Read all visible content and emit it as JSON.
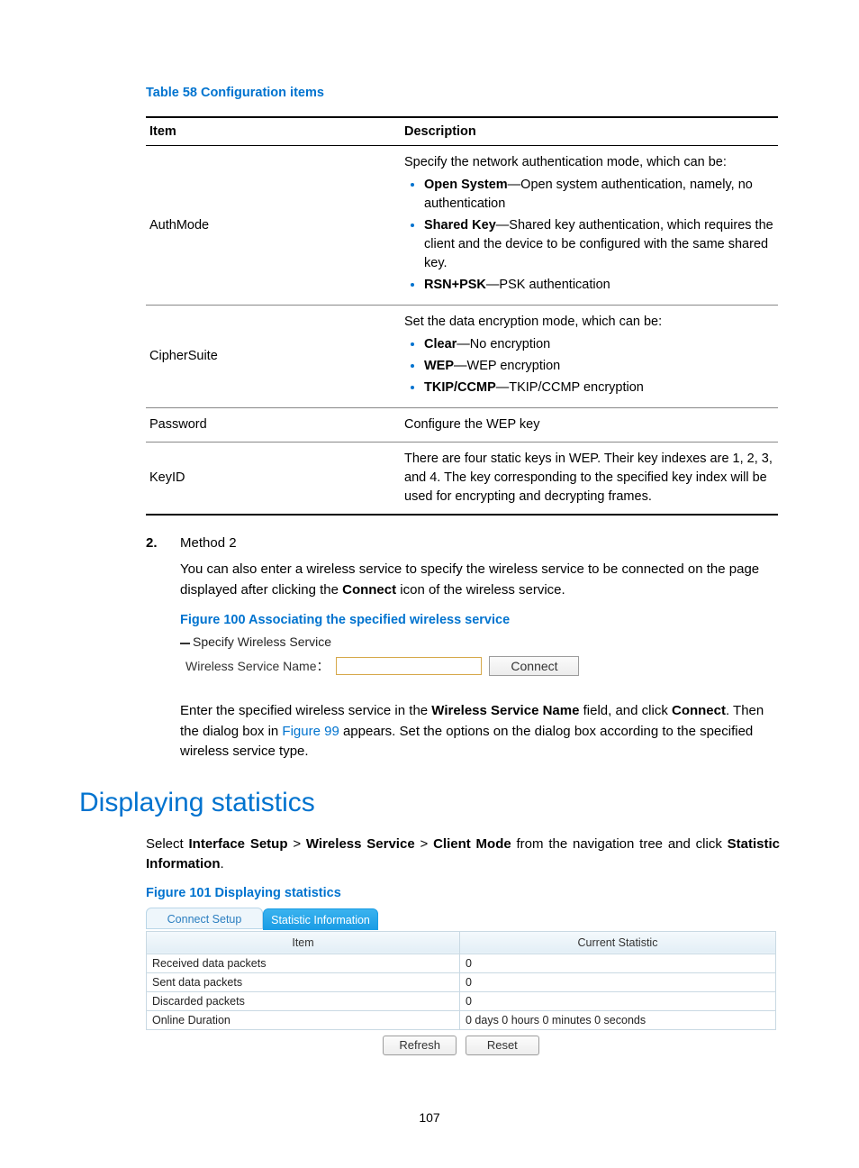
{
  "table58": {
    "caption": "Table 58 Configuration items",
    "headers": [
      "Item",
      "Description"
    ],
    "rows": [
      {
        "item": "AuthMode",
        "intro": "Specify the network authentication mode, which can be:",
        "bullets": [
          {
            "term": "Open System",
            "text": "—Open system authentication, namely, no authentication"
          },
          {
            "term": "Shared Key",
            "text": "—Shared key authentication, which requires the client and the device to be configured with the same shared key."
          },
          {
            "term": "RSN+PSK",
            "text": "—PSK authentication"
          }
        ]
      },
      {
        "item": "CipherSuite",
        "intro": "Set the data encryption mode, which can be:",
        "bullets": [
          {
            "term": "Clear",
            "text": "—No encryption"
          },
          {
            "term": "WEP",
            "text": "—WEP encryption"
          },
          {
            "term": "TKIP/CCMP",
            "text": "—TKIP/CCMP encryption"
          }
        ]
      },
      {
        "item": "Password",
        "text": "Configure the WEP key"
      },
      {
        "item": "KeyID",
        "text": "There are four static keys in WEP. Their key indexes are 1, 2, 3, and 4. The key corresponding to the specified key index will be used for encrypting and decrypting frames."
      }
    ]
  },
  "method2": {
    "number": "2.",
    "label": "Method 2",
    "body_pre": "You can also enter a wireless service to specify the wireless service to be connected on the page displayed after clicking the ",
    "body_bold": "Connect",
    "body_post": " icon of the wireless service."
  },
  "figure100": {
    "caption": "Figure 100 Associating the specified wireless service",
    "section": "Specify Wireless Service",
    "label": "Wireless Service Name：",
    "value": "",
    "button": "Connect"
  },
  "post_fig": {
    "t1": "Enter the specified wireless service in the ",
    "b1": "Wireless Service Name",
    "t2": " field, and click ",
    "b2": "Connect",
    "t3": ". Then the dialog box in ",
    "link": "Figure 99",
    "t4": " appears. Set the options on the dialog box according to the specified wireless service type."
  },
  "h1": "Displaying statistics",
  "nav": {
    "t1": "Select ",
    "b1": "Interface Setup",
    "sep": " > ",
    "b2": "Wireless Service",
    "b3": "Client Mode",
    "t2": " from the navigation tree and click ",
    "b4": "Statistic Information",
    "t3": "."
  },
  "figure101": {
    "caption": "Figure 101 Displaying statistics",
    "tabs": {
      "inactive": "Connect Setup",
      "active": "Statistic Information"
    },
    "headers": [
      "Item",
      "Current Statistic"
    ],
    "rows": [
      {
        "item": "Received data packets",
        "val": "0"
      },
      {
        "item": "Sent data packets",
        "val": "0"
      },
      {
        "item": "Discarded packets",
        "val": "0"
      },
      {
        "item": "Online Duration",
        "val": "0 days 0 hours 0 minutes 0 seconds"
      }
    ],
    "buttons": {
      "refresh": "Refresh",
      "reset": "Reset"
    }
  },
  "page_number": "107"
}
